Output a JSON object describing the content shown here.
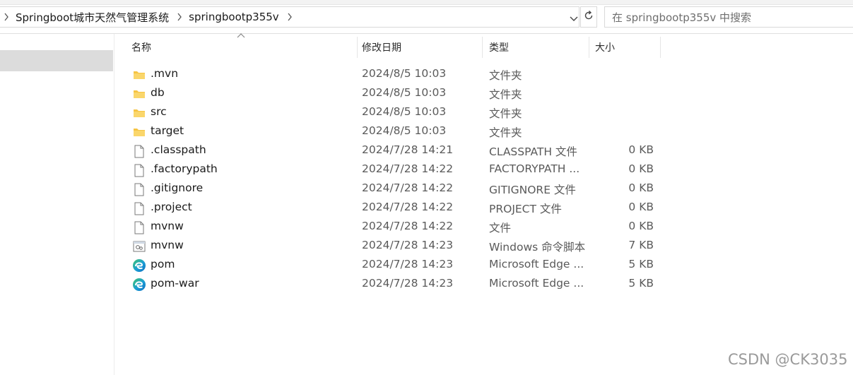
{
  "breadcrumb": {
    "items": [
      "Springboot城市天然气管理系统",
      "springbootp355v"
    ]
  },
  "search": {
    "placeholder": "在 springbootp355v 中搜索"
  },
  "columns": {
    "name": "名称",
    "date": "修改日期",
    "type": "类型",
    "size": "大小"
  },
  "files": [
    {
      "name": ".mvn",
      "date": "2024/8/5 10:03",
      "type": "文件夹",
      "size": "",
      "icon": "folder-icon"
    },
    {
      "name": "db",
      "date": "2024/8/5 10:03",
      "type": "文件夹",
      "size": "",
      "icon": "folder-icon"
    },
    {
      "name": "src",
      "date": "2024/8/5 10:03",
      "type": "文件夹",
      "size": "",
      "icon": "folder-icon"
    },
    {
      "name": "target",
      "date": "2024/8/5 10:03",
      "type": "文件夹",
      "size": "",
      "icon": "folder-icon"
    },
    {
      "name": ".classpath",
      "date": "2024/7/28 14:21",
      "type": "CLASSPATH 文件",
      "size": "0 KB",
      "icon": "file-icon"
    },
    {
      "name": ".factorypath",
      "date": "2024/7/28 14:22",
      "type": "FACTORYPATH ...",
      "size": "0 KB",
      "icon": "file-icon"
    },
    {
      "name": ".gitignore",
      "date": "2024/7/28 14:22",
      "type": "GITIGNORE 文件",
      "size": "0 KB",
      "icon": "file-icon"
    },
    {
      "name": ".project",
      "date": "2024/7/28 14:22",
      "type": "PROJECT 文件",
      "size": "0 KB",
      "icon": "file-icon"
    },
    {
      "name": "mvnw",
      "date": "2024/7/28 14:22",
      "type": "文件",
      "size": "0 KB",
      "icon": "file-icon"
    },
    {
      "name": "mvnw",
      "date": "2024/7/28 14:23",
      "type": "Windows 命令脚本",
      "size": "7 KB",
      "icon": "script-icon"
    },
    {
      "name": "pom",
      "date": "2024/7/28 14:23",
      "type": "Microsoft Edge ...",
      "size": "5 KB",
      "icon": "edge-icon"
    },
    {
      "name": "pom-war",
      "date": "2024/7/28 14:23",
      "type": "Microsoft Edge ...",
      "size": "5 KB",
      "icon": "edge-icon"
    }
  ],
  "watermark": "CSDN @CK3035",
  "colors": {
    "folder": "#f6c443",
    "selection": "#dcdcdc",
    "edge_blue": "#0f6cbd",
    "edge_green": "#3ec46d"
  }
}
